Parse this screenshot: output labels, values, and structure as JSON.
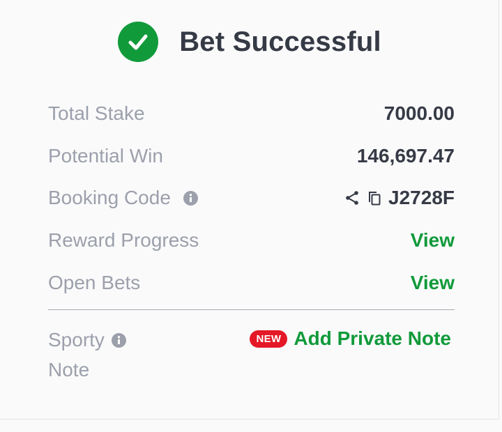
{
  "header": {
    "title": "Bet Successful",
    "accent_color": "#119a3a",
    "icon": "check-circle-icon"
  },
  "summary": {
    "total_stake_label": "Total Stake",
    "total_stake_value": "7000.00",
    "potential_win_label": "Potential Win",
    "potential_win_value": "146,697.47",
    "booking_code_label": "Booking Code",
    "booking_code_value": "J2728F",
    "reward_progress_label": "Reward Progress",
    "reward_progress_link": "View",
    "open_bets_label": "Open Bets",
    "open_bets_link": "View"
  },
  "note": {
    "label_line1": "Sporty",
    "label_line2": "Note",
    "badge": "NEW",
    "badge_color": "#e41827",
    "action": "Add Private Note"
  },
  "icons": [
    "check-circle-icon",
    "info-icon",
    "share-icon",
    "copy-icon"
  ]
}
